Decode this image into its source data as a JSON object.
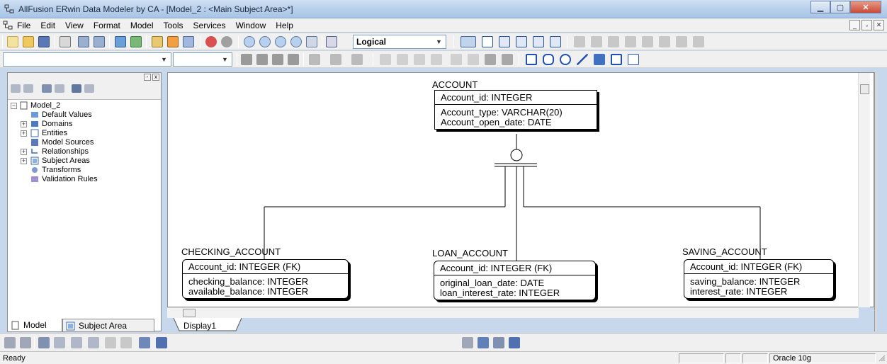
{
  "window": {
    "title": "AllFusion ERwin Data Modeler by CA - [Model_2 : <Main Subject Area>*]",
    "minimize": "▁",
    "maximize": "▢",
    "close": "✕"
  },
  "menu": {
    "items": [
      "File",
      "Edit",
      "View",
      "Format",
      "Model",
      "Tools",
      "Services",
      "Window",
      "Help"
    ],
    "mdi_minimize": "_",
    "mdi_restore": "▫",
    "mdi_close": "✕"
  },
  "toolbar": {
    "view_mode": "Logical",
    "combo_arrow": "▼"
  },
  "explorer": {
    "root": "Model_2",
    "items": [
      {
        "label": "Default Values",
        "expandable": false
      },
      {
        "label": "Domains",
        "expandable": true
      },
      {
        "label": "Entities",
        "expandable": true
      },
      {
        "label": "Model Sources",
        "expandable": false
      },
      {
        "label": "Relationships",
        "expandable": true
      },
      {
        "label": "Subject Areas",
        "expandable": true
      },
      {
        "label": "Transforms",
        "expandable": false
      },
      {
        "label": "Validation Rules",
        "expandable": false
      }
    ],
    "expand_symbol": "+",
    "collapse_symbol": "−",
    "tab_model": "Model",
    "tab_subject_area": "Subject Area",
    "pane_pin": "-",
    "pane_close": "x"
  },
  "diagram": {
    "tab_label": "Display1",
    "entities": {
      "account": {
        "name": "ACCOUNT",
        "pk": "Account_id: INTEGER",
        "attrs": [
          "Account_type: VARCHAR(20)",
          "Account_open_date: DATE"
        ]
      },
      "checking": {
        "name": "CHECKING_ACCOUNT",
        "pk": "Account_id: INTEGER (FK)",
        "attrs": [
          "checking_balance: INTEGER",
          "available_balance: INTEGER"
        ]
      },
      "loan": {
        "name": "LOAN_ACCOUNT",
        "pk": "Account_id: INTEGER (FK)",
        "attrs": [
          "original_loan_date: DATE",
          "loan_interest_rate: INTEGER"
        ]
      },
      "saving": {
        "name": "SAVING_ACCOUNT",
        "pk": "Account_id: INTEGER (FK)",
        "attrs": [
          "saving_balance: INTEGER",
          "interest_rate: INTEGER"
        ]
      }
    }
  },
  "status": {
    "text": "Ready",
    "database": "Oracle 10g"
  },
  "colors": {
    "title_bar": "#b8d0ec",
    "close_button": "#c94a36",
    "canvas": "#ffffff"
  }
}
